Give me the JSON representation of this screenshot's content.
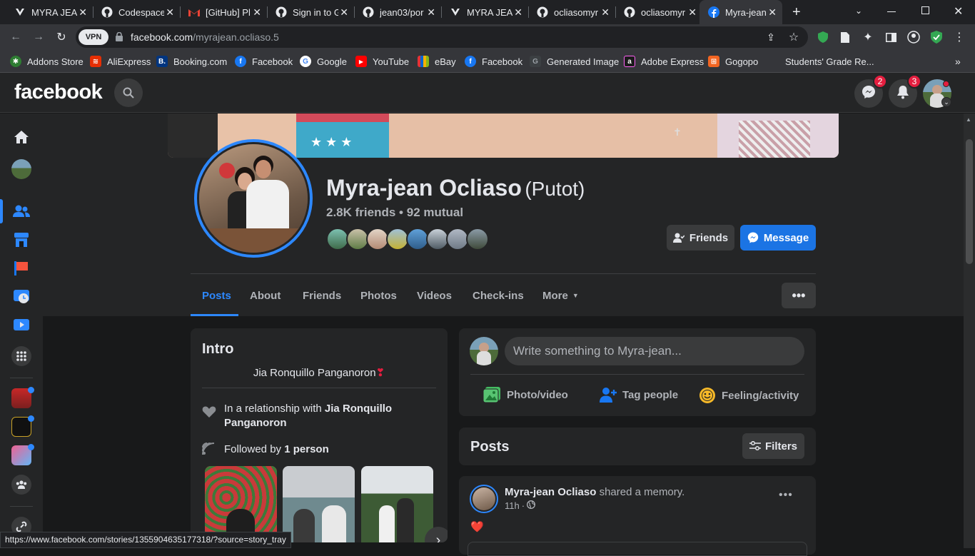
{
  "browser": {
    "tabs": [
      {
        "title": "MYRA JEAN",
        "icon": "v-logo-icon"
      },
      {
        "title": "Codespaces",
        "icon": "github-icon"
      },
      {
        "title": "[GitHub] Pl",
        "icon": "gmail-icon"
      },
      {
        "title": "Sign in to G",
        "icon": "github-icon"
      },
      {
        "title": "jean03/por",
        "icon": "github-icon"
      },
      {
        "title": "MYRA JEAN",
        "icon": "v-logo-icon"
      },
      {
        "title": "ocliasomyr",
        "icon": "github-icon"
      },
      {
        "title": "ocliasomyr",
        "icon": "github-icon"
      },
      {
        "title": "Myra-jean",
        "icon": "facebook-icon"
      }
    ],
    "url_host": "facebook.com",
    "url_path": "/myrajean.ocliaso.5",
    "vpn_label": "VPN",
    "bookmarks": [
      {
        "label": "Addons Store",
        "color": "#2e7d32"
      },
      {
        "label": "AliExpress",
        "color": "#e62e04"
      },
      {
        "label": "Booking.com",
        "color": "#003580"
      },
      {
        "label": "Facebook",
        "color": "#1877f2"
      },
      {
        "label": "Google",
        "color": "#ffffff"
      },
      {
        "label": "YouTube",
        "color": "#ff0000"
      },
      {
        "label": "eBay",
        "color": "#f5af02"
      },
      {
        "label": "Facebook",
        "color": "#1877f2"
      },
      {
        "label": "Generated Image",
        "color": "#9aa0a6"
      },
      {
        "label": "Adobe Express",
        "color": "#1b1b1b"
      },
      {
        "label": "Gogopo",
        "color": "#f26522"
      },
      {
        "label": "Students' Grade Re...",
        "color": "#35363a"
      }
    ],
    "status_url": "https://www.facebook.com/stories/1355904635177318/?source=story_tray"
  },
  "fb": {
    "logo": "facebook",
    "messenger_badge": "2",
    "notifications_badge": "3"
  },
  "profile": {
    "name": "Myra-jean Ocliaso",
    "nickname": "(Putot)",
    "friends_count": "2.8K friends",
    "mutual": "92 mutual",
    "separator": "•",
    "friends_button": "Friends",
    "message_button": "Message",
    "tabs": [
      "Posts",
      "About",
      "Friends",
      "Photos",
      "Videos",
      "Check-ins",
      "More"
    ],
    "active_tab": "Posts"
  },
  "intro": {
    "title": "Intro",
    "bio": "Jia Ronquillo Panganoron",
    "relationship_prefix": "In a relationship with",
    "relationship_name": "Jia Ronquillo Panganoron",
    "followed_prefix": "Followed by",
    "followed_count": "1 person"
  },
  "composer": {
    "placeholder": "Write something to Myra-jean...",
    "photo_video": "Photo/video",
    "tag_people": "Tag people",
    "feeling": "Feeling/activity"
  },
  "posts": {
    "title": "Posts",
    "filters": "Filters",
    "items": [
      {
        "author": "Myra-jean Ocliaso",
        "action": "shared a memory.",
        "time": "11h",
        "body": "❤️"
      }
    ]
  },
  "colors": {
    "accent": "#2d88ff",
    "message_button": "#1b74e4",
    "badge": "#e41e3f",
    "card": "#242526",
    "page_bg": "#18191a"
  }
}
